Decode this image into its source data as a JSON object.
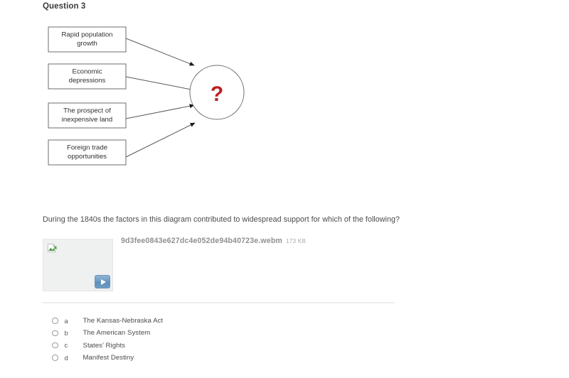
{
  "question": {
    "header": "Question 3",
    "prompt": "During the 1840s the factors in this diagram contributed to widespread support for which of the following?"
  },
  "diagram": {
    "center_symbol": "?",
    "center_symbol_color": "#bb2025",
    "factors": [
      {
        "line1": "Rapid population",
        "line2": "growth"
      },
      {
        "line1": "Economic",
        "line2": "depressions"
      },
      {
        "line1": "The prospect of",
        "line2": "inexpensive land"
      },
      {
        "line1": "Foreign trade",
        "line2": "opportunities"
      }
    ]
  },
  "attachment": {
    "filename": "9d3fee0843e627dc4e052de94b40723e.webm",
    "filesize": "173 KB",
    "thumbnail_icon": "broken-image-icon",
    "play_icon": "play-icon"
  },
  "options": [
    {
      "letter": "a",
      "label": "The Kansas-Nebraska Act"
    },
    {
      "letter": "b",
      "label": "The American System"
    },
    {
      "letter": "c",
      "label": "States’ Rights"
    },
    {
      "letter": "d",
      "label": "Manifest Destiny"
    }
  ]
}
